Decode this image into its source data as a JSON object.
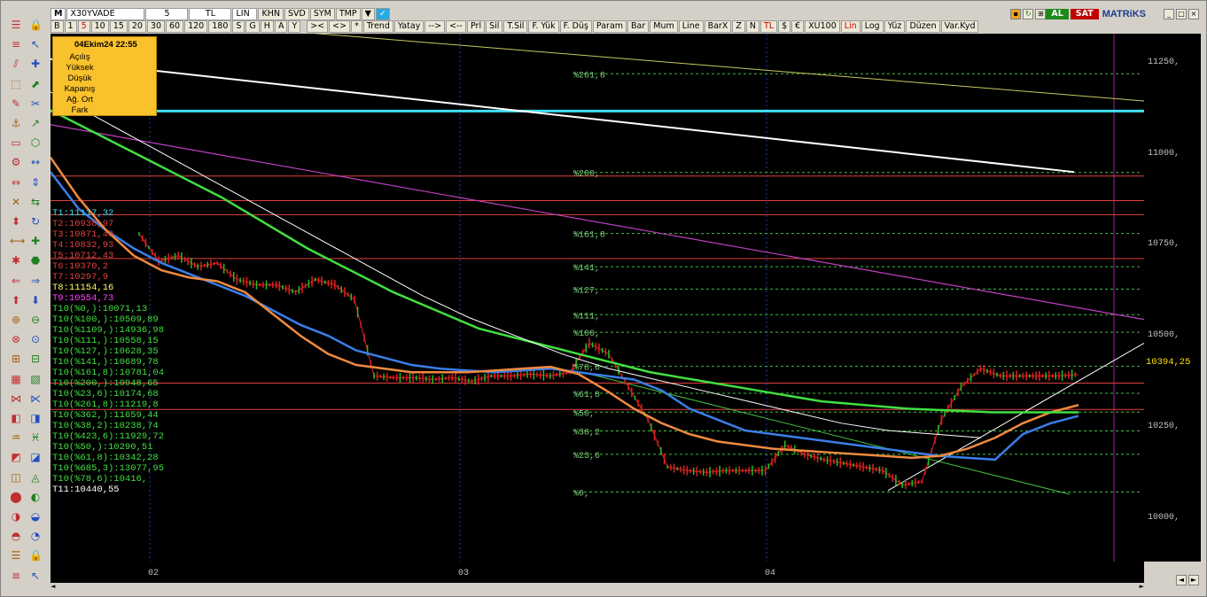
{
  "toolbar_row1": {
    "m_label": "M",
    "symbol": "X30YVADE",
    "period": "5",
    "currency": "TL",
    "scale": "LIN",
    "buttons": [
      "KHN",
      "SVD",
      "SYM",
      "TMP"
    ]
  },
  "toolbar_row2": {
    "intervals": [
      "B",
      "1",
      "5",
      "10",
      "15",
      "20",
      "30",
      "60",
      "120",
      "180",
      "S",
      "G",
      "H",
      "A",
      "Y"
    ],
    "selected_interval": "5",
    "tools": [
      "><",
      "<>",
      "*",
      "Trend",
      "Yatay",
      "-->",
      "<--",
      "Prl",
      "Sil",
      "T.Sil",
      "F. Yük",
      "F. Düş",
      "Param",
      "Bar",
      "Mum",
      "Line",
      "BarX",
      "Z",
      "N",
      "TL",
      "$",
      "€",
      "XU100",
      "Lin",
      "Log",
      "Yüz",
      "Düzen",
      "Var.Kyd"
    ],
    "red_tools": [
      "TL",
      "Lin"
    ]
  },
  "header_right": {
    "al_label": "AL",
    "sat_label": "SAT",
    "brand": "MATRiKS"
  },
  "info_box": {
    "date": "04Ekim24 22:55",
    "rows": [
      "Açılış",
      "Yüksek",
      "Düşük",
      "Kapanış",
      "Ağ. Ort",
      "Fark"
    ]
  },
  "legend": [
    {
      "text": "T1:11117,32",
      "color": "#40e0f0"
    },
    {
      "text": "T2:10938,97",
      "color": "#e04040"
    },
    {
      "text": "T3:10871,49",
      "color": "#e04040"
    },
    {
      "text": "T4:10832,93",
      "color": "#e04040"
    },
    {
      "text": "T5:10712,43",
      "color": "#e04040"
    },
    {
      "text": "T6:10370,2",
      "color": "#e04040"
    },
    {
      "text": "T7:10297,9",
      "color": "#e04040"
    },
    {
      "text": "T8:11154,16",
      "color": "#ffff60"
    },
    {
      "text": "T9:10554,73",
      "color": "#ff40ff"
    },
    {
      "text": "T10(%0,):10071,13",
      "color": "#40e040"
    },
    {
      "text": "T10(%100,):10509,89",
      "color": "#40e040"
    },
    {
      "text": "T10(%1109,):14936,98",
      "color": "#40e040"
    },
    {
      "text": "T10(%111,):10558,15",
      "color": "#40e040"
    },
    {
      "text": "T10(%127,):10628,35",
      "color": "#40e040"
    },
    {
      "text": "T10(%141,):10689,78",
      "color": "#40e040"
    },
    {
      "text": "T10(%161,8):10781,04",
      "color": "#40e040"
    },
    {
      "text": "T10(%200,):10948,65",
      "color": "#40e040"
    },
    {
      "text": "T10(%23,6):10174,68",
      "color": "#40e040"
    },
    {
      "text": "T10(%261,8):11219,8",
      "color": "#40e040"
    },
    {
      "text": "T10(%362,):11659,44",
      "color": "#40e040"
    },
    {
      "text": "T10(%38,2):10238,74",
      "color": "#40e040"
    },
    {
      "text": "T10(%423,6):11929,72",
      "color": "#40e040"
    },
    {
      "text": "T10(%50,):10290,51",
      "color": "#40e040"
    },
    {
      "text": "T10(%61,8):10342,28",
      "color": "#40e040"
    },
    {
      "text": "T10(%685,3):13077,95",
      "color": "#40e040"
    },
    {
      "text": "T10(%78,6):10416,",
      "color": "#40e040"
    },
    {
      "text": "T11:10440,55",
      "color": "#ffffff"
    }
  ],
  "fib_labels": [
    "%261,8",
    "%200,",
    "%161,8",
    "%141,",
    "%127,",
    "%111,",
    "%100,",
    "%78,6",
    "%61,8",
    "%50,",
    "%38,2",
    "%23,6",
    "%0,"
  ],
  "y_axis_labels": [
    "11250,",
    "11000,",
    "10750,",
    "10500,",
    "10250,",
    "10000,"
  ],
  "x_axis_labels": [
    "02",
    "03",
    "04"
  ],
  "last_price": "10394,25",
  "chart_data": {
    "type": "line",
    "ylim": [
      9880,
      11330
    ],
    "y_ticks": [
      11250,
      11000,
      10750,
      10500,
      10250,
      10000
    ],
    "x_ticks": [
      "02",
      "03",
      "04"
    ],
    "last": 10394.25,
    "fibonacci": [
      {
        "label": "%0,",
        "value": 10071.13
      },
      {
        "label": "%23,6",
        "value": 10174.68
      },
      {
        "label": "%38,2",
        "value": 10238.74
      },
      {
        "label": "%50,",
        "value": 10290.51
      },
      {
        "label": "%61,8",
        "value": 10342.28
      },
      {
        "label": "%78,6",
        "value": 10416
      },
      {
        "label": "%100,",
        "value": 10509.89
      },
      {
        "label": "%111,",
        "value": 10558.15
      },
      {
        "label": "%127,",
        "value": 10628.35
      },
      {
        "label": "%141,",
        "value": 10689.78
      },
      {
        "label": "%161,8",
        "value": 10781.04
      },
      {
        "label": "%200,",
        "value": 10948.65
      },
      {
        "label": "%261,8",
        "value": 11219.8
      }
    ],
    "horizontal_lines": [
      {
        "name": "T1",
        "value": 11117.32,
        "color": "#40e0f0"
      },
      {
        "name": "T2",
        "value": 10938.97,
        "color": "#e04040"
      },
      {
        "name": "T3",
        "value": 10871.49,
        "color": "#e04040"
      },
      {
        "name": "T4",
        "value": 10832.93,
        "color": "#e04040"
      },
      {
        "name": "T5",
        "value": 10712.43,
        "color": "#e04040"
      },
      {
        "name": "T6",
        "value": 10370.2,
        "color": "#e04040"
      },
      {
        "name": "T7",
        "value": 10297.9,
        "color": "#e04040"
      }
    ],
    "series": [
      {
        "name": "price",
        "color": "#e02020",
        "values": [
          10780,
          10705,
          10720,
          10690,
          10700,
          10655,
          10640,
          10640,
          10620,
          10655,
          10640,
          10600,
          10390,
          10385,
          10385,
          10380,
          10385,
          10375,
          10390,
          10390,
          10395,
          10390,
          10400,
          10480,
          10450,
          10360,
          10270,
          10140,
          10130,
          10125,
          10130,
          10130,
          10130,
          10200,
          10175,
          10160,
          10150,
          10140,
          10130,
          10090,
          10100,
          10270,
          10360,
          10410,
          10390,
          10390,
          10390,
          10390,
          10394
        ]
      },
      {
        "name": "ma-blue",
        "color": "#3a7ee8",
        "values": [
          10950,
          10850,
          10790,
          10740,
          10700,
          10670,
          10640,
          10610,
          10570,
          10530,
          10500,
          10460,
          10440,
          10420,
          10410,
          10405,
          10400,
          10405,
          10410,
          10400,
          10390,
          10380,
          10350,
          10300,
          10270,
          10240,
          10230,
          10220,
          10210,
          10200,
          10190,
          10180,
          10170,
          10165,
          10160,
          10230,
          10260,
          10280
        ]
      },
      {
        "name": "ma-orange",
        "color": "#f08a40",
        "values": [
          10990,
          10880,
          10790,
          10720,
          10680,
          10660,
          10650,
          10620,
          10560,
          10500,
          10450,
          10420,
          10410,
          10400,
          10400,
          10400,
          10405,
          10410,
          10415,
          10395,
          10350,
          10300,
          10260,
          10230,
          10210,
          10200,
          10190,
          10185,
          10180,
          10175,
          10170,
          10165,
          10170,
          10190,
          10220,
          10260,
          10290,
          10310
        ]
      },
      {
        "name": "ma-green",
        "color": "#40e040",
        "values": [
          11120,
          11060,
          11000,
          10940,
          10880,
          10810,
          10740,
          10680,
          10620,
          10570,
          10520,
          10490,
          10460,
          10430,
          10400,
          10380,
          10360,
          10340,
          10320,
          10310,
          10300,
          10295,
          10290,
          10290,
          10290
        ]
      },
      {
        "name": "ma-white",
        "color": "#ffffff",
        "values": [
          11170,
          11100,
          11030,
          10960,
          10890,
          10820,
          10750,
          10680,
          10610,
          10550,
          10500,
          10450,
          10410,
          10380,
          10350,
          10320,
          10290,
          10260,
          10240,
          10230,
          10220
        ]
      }
    ]
  }
}
